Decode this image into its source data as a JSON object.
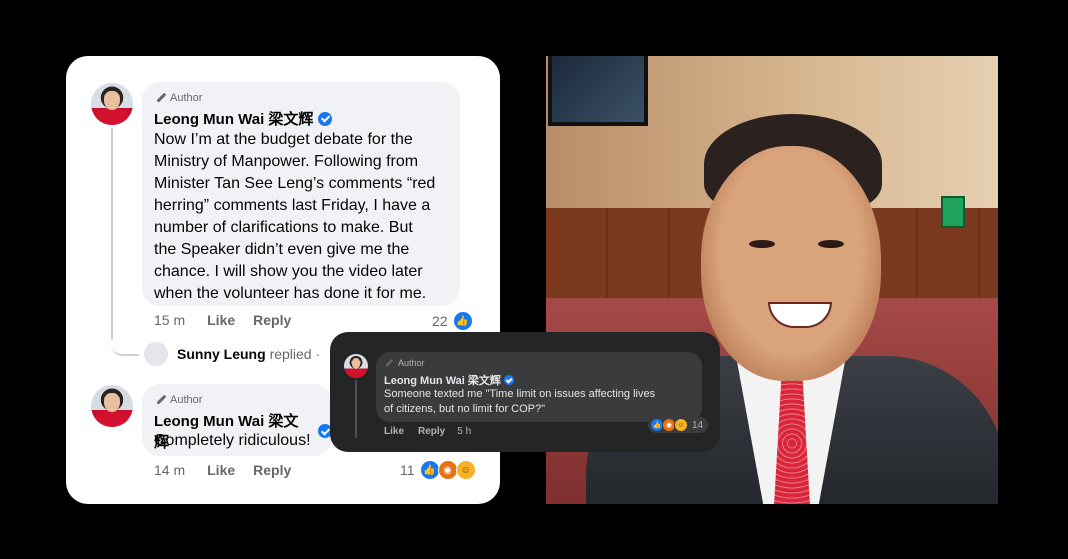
{
  "light_card": {
    "comment1": {
      "author_tag": "Author",
      "name": "Leong Mun Wai 梁文辉",
      "lines": [
        "Now I’m at the budget debate for the",
        "Ministry of Manpower.  Following from",
        "Minister Tan See Leng’s comments “red",
        "herring” comments last Friday, I have a",
        "number of clarifications to make.  But",
        "the Speaker didn’t even give me the",
        "chance.  I will show you the video later",
        "when the volunteer has done it for me."
      ],
      "time": "15 m",
      "like": "Like",
      "reply": "Reply",
      "reaction_count": "22"
    },
    "reply_preview": {
      "name": "Sunny Leung",
      "action": "replied",
      "dot": "·"
    },
    "comment2": {
      "author_tag": "Author",
      "name": "Leong Mun Wai 梁文辉",
      "text": "Completely ridiculous!",
      "time": "14 m",
      "like": "Like",
      "reply": "Reply",
      "reaction_count": "11"
    }
  },
  "dark_card": {
    "author_tag": "Author",
    "name": "Leong Mun Wai 梁文辉",
    "lines": [
      "Someone texted me \"Time limit on issues affecting lives",
      "of citizens, but no limit for COP?\""
    ],
    "like": "Like",
    "reply": "Reply",
    "time": "5 h",
    "reaction_count": "14"
  },
  "icons": {
    "reactions": [
      "like-icon",
      "angry-icon",
      "haha-icon"
    ],
    "verified": "verified-badge-icon",
    "author": "pen-icon"
  },
  "colors": {
    "facebook_blue": "#1877f2",
    "dark_bg": "#242526",
    "bubble_light": "#f0f2f5"
  }
}
